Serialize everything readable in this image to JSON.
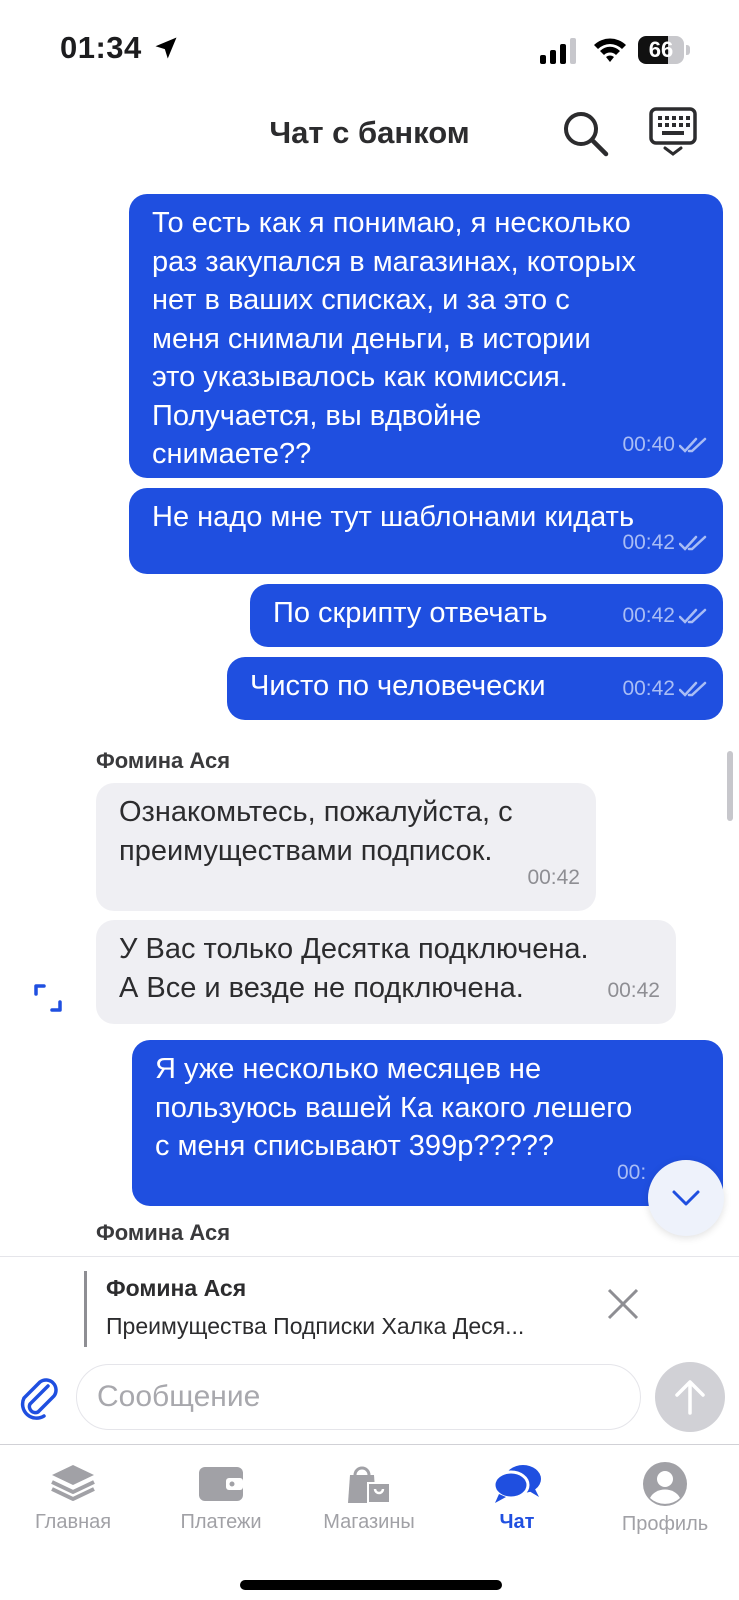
{
  "status_bar": {
    "time": "01:34",
    "battery": "66",
    "battery_level": 0.66
  },
  "header": {
    "title": "Чат с банком"
  },
  "messages": [
    {
      "direction": "out",
      "text": "То есть как я понимаю, я несколько\nраз закупался в магазинах, которых\nнет в ваших списках, и за это с\nменя снимали деньги, в истории\nэто указывалось как комиссия.\nПолучается, вы вдвойне\nснимаете??",
      "time": "00:40"
    },
    {
      "direction": "out",
      "text": "Не надо мне тут шаблонами кидать",
      "time": "00:42"
    },
    {
      "direction": "out",
      "text": "По скрипту отвечать",
      "time": "00:42"
    },
    {
      "direction": "out",
      "text": "Чисто по человечески",
      "time": "00:42"
    },
    {
      "direction": "in",
      "sender": "Фомина Ася",
      "text": "Ознакомьтесь, пожалуйста, с\nпреимуществами подписок.",
      "time": "00:42"
    },
    {
      "direction": "in",
      "text": "У Вас только Десятка подключена.\nА Все и везде не подключена.",
      "time": "00:42"
    },
    {
      "direction": "out",
      "text": "Я уже несколько месяцев не\nпользуюсь вашей Ка какого лешего\nс меня списывают 399р?????",
      "time": "00:"
    },
    {
      "direction": "in",
      "sender": "Фомина Ася"
    }
  ],
  "reply_panel": {
    "name": "Фомина Ася",
    "text": "Преимущества Подписки Халка Деся..."
  },
  "composer": {
    "placeholder": "Сообщение"
  },
  "tabs": [
    {
      "label": "Главная",
      "icon": "layers-icon",
      "active": false
    },
    {
      "label": "Платежи",
      "icon": "wallet-icon",
      "active": false
    },
    {
      "label": "Магазины",
      "icon": "shopping-bags-icon",
      "active": false
    },
    {
      "label": "Чат",
      "icon": "chat-bubbles-icon",
      "active": true
    },
    {
      "label": "Профиль",
      "icon": "profile-icon",
      "active": false
    }
  ],
  "colors": {
    "accent": "#1f4fe0",
    "incoming_bubble": "#efeff3",
    "inactive_tab": "#a1a1a6"
  }
}
